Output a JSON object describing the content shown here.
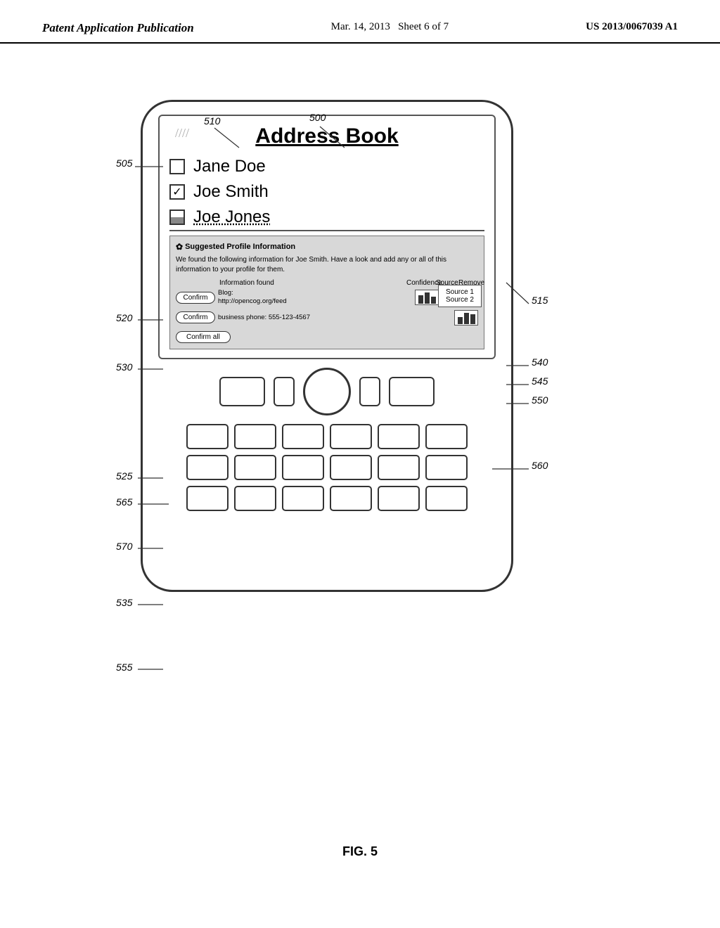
{
  "header": {
    "left": "Patent Application Publication",
    "center_date": "Mar. 14, 2013",
    "center_sheet": "Sheet 6 of 7",
    "right": "US 2013/0067039 A1"
  },
  "diagram": {
    "labels": {
      "500": "500",
      "505": "505",
      "510": "510",
      "515": "515",
      "520": "520",
      "525": "525",
      "530": "530",
      "535": "535",
      "540": "540",
      "545": "545",
      "550": "550",
      "555": "555",
      "560": "560",
      "565": "565",
      "570": "570"
    },
    "screen": {
      "title": "Address Book",
      "contacts": [
        {
          "name": "Jane Doe",
          "checked": false
        },
        {
          "name": "Joe Smith",
          "checked": true
        },
        {
          "name": "Joe Jones",
          "checked": "partial"
        }
      ],
      "popup": {
        "header": "Suggested Profile Information",
        "description": "We found the following information for Joe Smith. Have a look and add any or all of this information to your profile for them.",
        "columns": [
          "Information found",
          "Confidence",
          "Source",
          "Remove"
        ],
        "rows": [
          {
            "confirm": "Confirm",
            "info": "Blog:\nhttp://opencog.org/feed",
            "bars": 3,
            "source_icon": "↺",
            "remove_icon": "⊖"
          },
          {
            "confirm": "Confirm",
            "info": "business phone: 555-123-4567",
            "bars": 3,
            "source_tooltip_lines": [
              "Source 1",
              "Source 2"
            ]
          }
        ],
        "confirm_all": "Confirm all"
      }
    },
    "nav_buttons": {
      "left_btn": "",
      "circle": "",
      "right_btn": ""
    },
    "keypad_rows": [
      [
        "",
        "",
        "",
        "",
        "",
        ""
      ],
      [
        "",
        "",
        "",
        "",
        "",
        ""
      ],
      [
        "",
        "",
        "",
        "",
        "",
        ""
      ]
    ],
    "figure_caption": "FIG. 5"
  }
}
